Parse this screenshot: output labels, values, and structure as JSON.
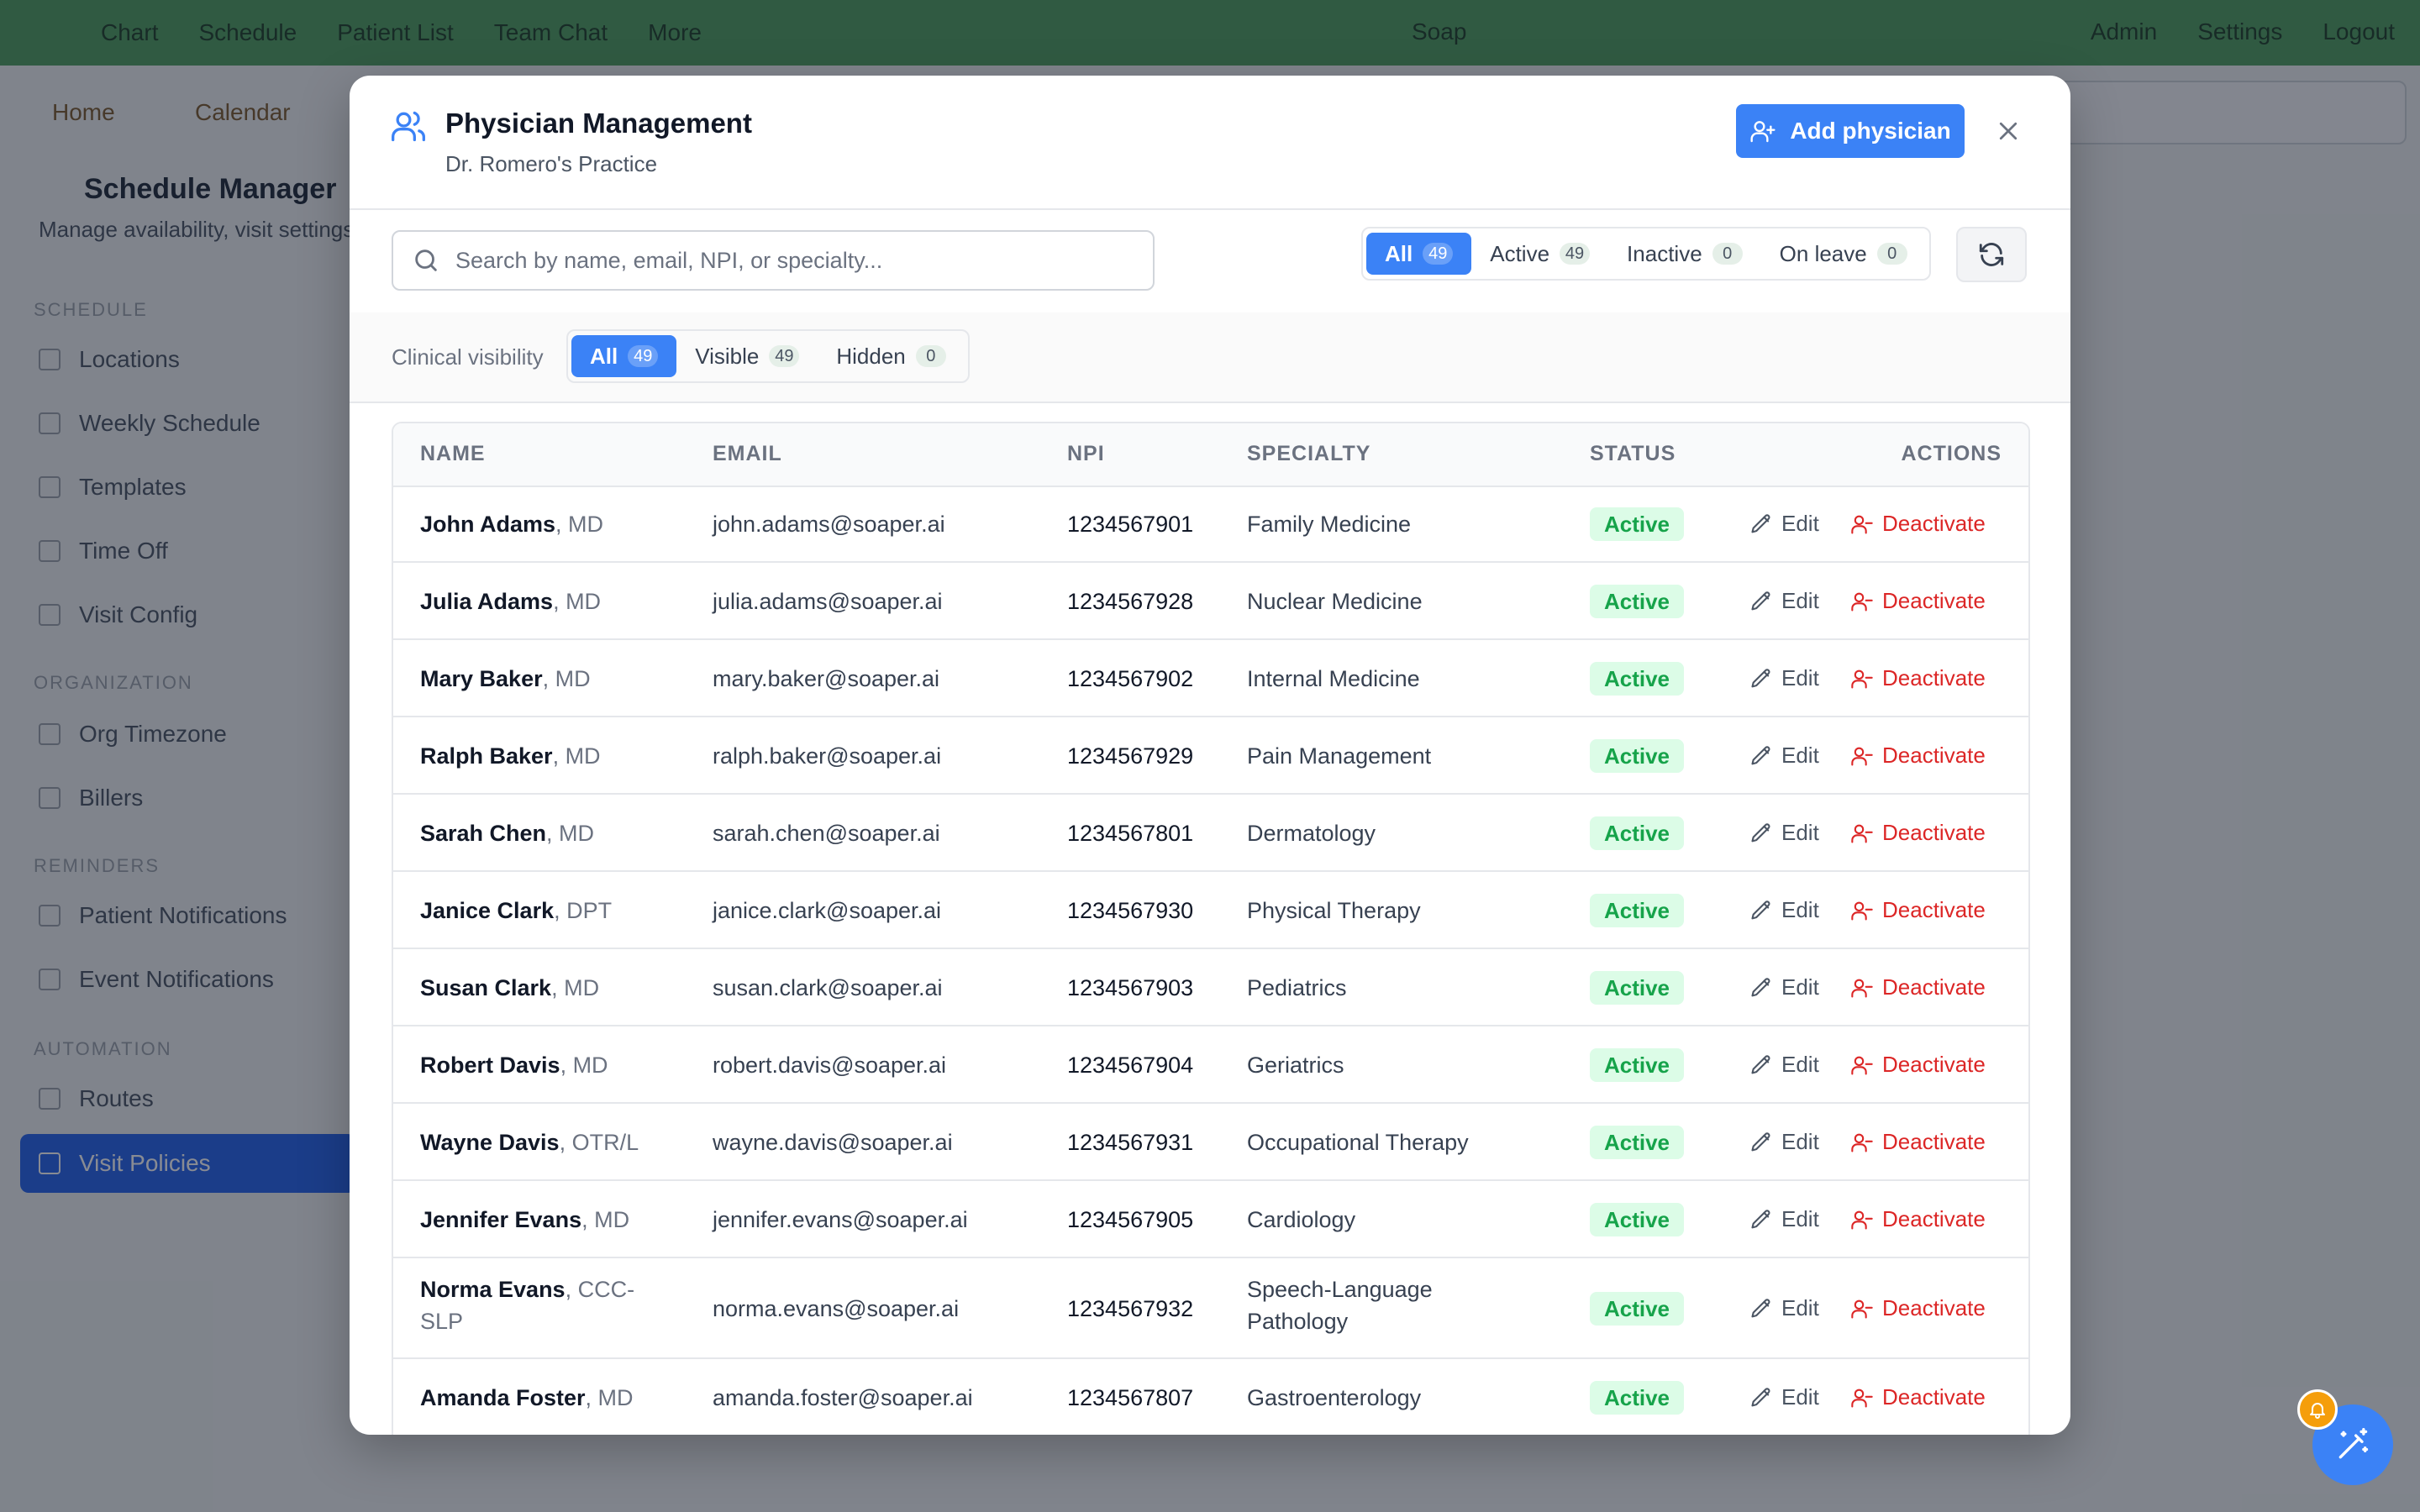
{
  "background_app": {
    "nav": [
      "Chart",
      "Schedule",
      "Patient List",
      "Team Chat",
      "More"
    ],
    "center_label": "Soap",
    "right": [
      "Admin",
      "Settings",
      "Logout"
    ],
    "crumbs": [
      "Home",
      "Calendar"
    ],
    "page_title": "Schedule Manager",
    "page_subtitle": "Manage availability, visit settings and notifications",
    "sections": [
      {
        "label": "SCHEDULE",
        "items": [
          "Locations",
          "Weekly Schedule",
          "Templates",
          "Time Off",
          "Visit Config"
        ]
      },
      {
        "label": "ORGANIZATION",
        "items": [
          "Org Timezone",
          "Billers"
        ]
      },
      {
        "label": "REMINDERS",
        "items": [
          "Patient Notifications",
          "Event Notifications"
        ]
      },
      {
        "label": "AUTOMATION",
        "items": [
          "Routes",
          "Visit Policies"
        ]
      }
    ]
  },
  "modal": {
    "title": "Physician Management",
    "subtitle": "Dr. Romero's Practice",
    "add_button": "Add physician",
    "search_placeholder": "Search by name, email, NPI, or specialty...",
    "status_filters": [
      {
        "label": "All",
        "count": "49",
        "selected": true
      },
      {
        "label": "Active",
        "count": "49",
        "selected": false
      },
      {
        "label": "Inactive",
        "count": "0",
        "selected": false
      },
      {
        "label": "On leave",
        "count": "0",
        "selected": false
      }
    ],
    "visibility_label": "Clinical visibility",
    "visibility_filters": [
      {
        "label": "All",
        "count": "49",
        "selected": true
      },
      {
        "label": "Visible",
        "count": "49",
        "selected": false
      },
      {
        "label": "Hidden",
        "count": "0",
        "selected": false
      }
    ],
    "table": {
      "columns": [
        "NAME",
        "EMAIL",
        "NPI",
        "SPECIALTY",
        "STATUS",
        "ACTIONS"
      ],
      "edit_label": "Edit",
      "deactivate_label": "Deactivate",
      "rows": [
        {
          "name": "John Adams",
          "cred": ", MD",
          "email": "john.adams@soaper.ai",
          "npi": "1234567901",
          "specialty": "Family Medicine",
          "status": "Active"
        },
        {
          "name": "Julia Adams",
          "cred": ", MD",
          "email": "julia.adams@soaper.ai",
          "npi": "1234567928",
          "specialty": "Nuclear Medicine",
          "status": "Active"
        },
        {
          "name": "Mary Baker",
          "cred": ", MD",
          "email": "mary.baker@soaper.ai",
          "npi": "1234567902",
          "specialty": "Internal Medicine",
          "status": "Active"
        },
        {
          "name": "Ralph Baker",
          "cred": ", MD",
          "email": "ralph.baker@soaper.ai",
          "npi": "1234567929",
          "specialty": "Pain Management",
          "status": "Active"
        },
        {
          "name": "Sarah Chen",
          "cred": ", MD",
          "email": "sarah.chen@soaper.ai",
          "npi": "1234567801",
          "specialty": "Dermatology",
          "status": "Active"
        },
        {
          "name": "Janice Clark",
          "cred": ", DPT",
          "email": "janice.clark@soaper.ai",
          "npi": "1234567930",
          "specialty": "Physical Therapy",
          "status": "Active"
        },
        {
          "name": "Susan Clark",
          "cred": ", MD",
          "email": "susan.clark@soaper.ai",
          "npi": "1234567903",
          "specialty": "Pediatrics",
          "status": "Active"
        },
        {
          "name": "Robert Davis",
          "cred": ", MD",
          "email": "robert.davis@soaper.ai",
          "npi": "1234567904",
          "specialty": "Geriatrics",
          "status": "Active"
        },
        {
          "name": "Wayne Davis",
          "cred": ", OTR/L",
          "email": "wayne.davis@soaper.ai",
          "npi": "1234567931",
          "specialty": "Occupational Therapy",
          "status": "Active"
        },
        {
          "name": "Jennifer Evans",
          "cred": ", MD",
          "email": "jennifer.evans@soaper.ai",
          "npi": "1234567905",
          "specialty": "Cardiology",
          "status": "Active"
        },
        {
          "name": "Norma Evans",
          "cred": ", CCC-SLP",
          "email": "norma.evans@soaper.ai",
          "npi": "1234567932",
          "specialty": "Speech-Language Pathology",
          "status": "Active"
        },
        {
          "name": "Amanda Foster",
          "cred": ", MD",
          "email": "amanda.foster@soaper.ai",
          "npi": "1234567807",
          "specialty": "Gastroenterology",
          "status": "Active"
        }
      ]
    }
  },
  "colors": {
    "primary": "#3b82f6",
    "danger": "#dc2626",
    "success_text": "#16a34a",
    "success_bg": "#dcfce7",
    "topbar": "#4f9d5d",
    "notification": "#f59e0b"
  },
  "icons": {
    "title": "users-icon",
    "add": "user-plus-icon",
    "close": "close-icon",
    "search": "search-icon",
    "refresh": "refresh-icon",
    "edit": "pencil-icon",
    "deactivate": "user-minus-icon",
    "fab": "magic-wand-icon",
    "badge": "bell-icon"
  }
}
